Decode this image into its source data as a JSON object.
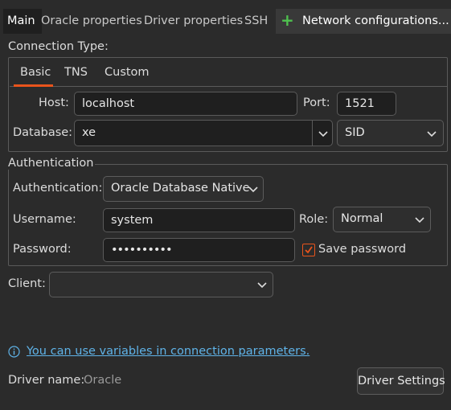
{
  "tabs": [
    {
      "label": "Main"
    },
    {
      "label": "Oracle properties"
    },
    {
      "label": "Driver properties"
    },
    {
      "label": "SSH"
    }
  ],
  "network_tab": {
    "label": "Network configurations..."
  },
  "connection_type": {
    "label": "Connection Type:",
    "tabs": [
      "Basic",
      "TNS",
      "Custom"
    ],
    "active_tab": "Basic"
  },
  "host": {
    "label": "Host:",
    "value": "localhost"
  },
  "port": {
    "label": "Port:",
    "value": "1521"
  },
  "database": {
    "label": "Database:",
    "value": "xe",
    "type_value": "SID"
  },
  "authentication_group": {
    "title": "Authentication"
  },
  "authentication": {
    "label": "Authentication:",
    "value": "Oracle Database Native"
  },
  "username": {
    "label": "Username:",
    "value": "system"
  },
  "role": {
    "label": "Role:",
    "value": "Normal"
  },
  "password": {
    "label": "Password:",
    "value": "••••••••••"
  },
  "save_password": {
    "label": "Save password",
    "checked": true
  },
  "client": {
    "label": "Client:",
    "value": ""
  },
  "info": {
    "link_text": "You can use variables in connection parameters."
  },
  "driver": {
    "label": "Driver name:",
    "value": "Oracle",
    "settings_button": "Driver Settings"
  },
  "colors": {
    "accent": "#e9541c",
    "link": "#5fb3e8",
    "add": "#4fc14f"
  }
}
